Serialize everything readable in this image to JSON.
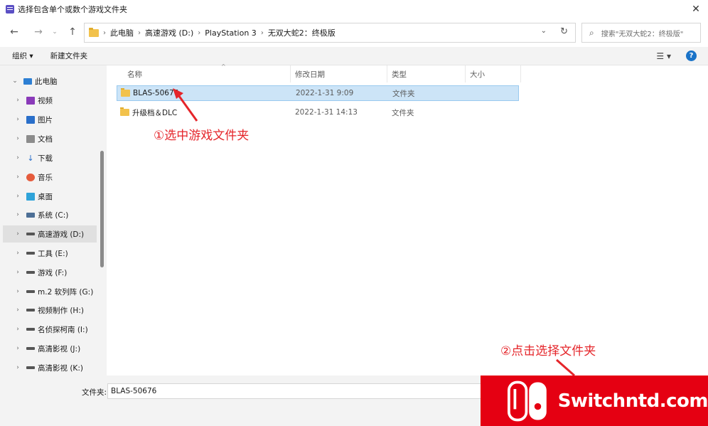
{
  "window": {
    "title": "选择包含单个或数个游戏文件夹",
    "close_glyph": "✕"
  },
  "nav": {
    "back": "←",
    "forward": "→",
    "recent": "⌄",
    "up": "↑"
  },
  "address": {
    "crumbs": [
      "此电脑",
      "高速游戏 (D:)",
      "PlayStation 3",
      "无双大蛇2：终极版"
    ],
    "separator": "›",
    "dropdown": "⌄",
    "refresh": "↻"
  },
  "search": {
    "placeholder": "搜索\"无双大蛇2：终极版\"",
    "icon": "search-icon"
  },
  "toolbar": {
    "organize": "组织 ▾",
    "new_folder": "新建文件夹",
    "view_glyph": "☰ ▾",
    "help_glyph": "?"
  },
  "tree": {
    "items": [
      {
        "label": "此电脑",
        "chev": "⌄",
        "icon": "pc-icon"
      },
      {
        "label": "视频",
        "chev": "›",
        "icon": "video-icon"
      },
      {
        "label": "图片",
        "chev": "›",
        "icon": "picture-icon"
      },
      {
        "label": "文档",
        "chev": "›",
        "icon": "document-icon"
      },
      {
        "label": "下载",
        "chev": "›",
        "icon": "download-icon"
      },
      {
        "label": "音乐",
        "chev": "›",
        "icon": "music-icon"
      },
      {
        "label": "桌面",
        "chev": "›",
        "icon": "desktop-icon"
      },
      {
        "label": "系统 (C:)",
        "chev": "›",
        "icon": "system-drive-icon"
      },
      {
        "label": "高速游戏 (D:)",
        "chev": "›",
        "icon": "drive-icon"
      },
      {
        "label": "工具 (E:)",
        "chev": "›",
        "icon": "drive-icon"
      },
      {
        "label": "游戏 (F:)",
        "chev": "›",
        "icon": "drive-icon"
      },
      {
        "label": "m.2 软列阵 (G:)",
        "chev": "›",
        "icon": "drive-icon"
      },
      {
        "label": "视频制作 (H:)",
        "chev": "›",
        "icon": "drive-icon"
      },
      {
        "label": "名侦探柯南 (I:)",
        "chev": "›",
        "icon": "drive-icon"
      },
      {
        "label": "高清影视 (J:)",
        "chev": "›",
        "icon": "drive-icon"
      },
      {
        "label": "高清影视 (K:)",
        "chev": "›",
        "icon": "drive-icon"
      }
    ]
  },
  "columns": {
    "name": "名称",
    "modified": "修改日期",
    "type": "类型",
    "size": "大小",
    "sort_glyph": "^"
  },
  "files": [
    {
      "name": "BLAS-50676",
      "modified": "2022-1-31 9:09",
      "type": "文件夹",
      "selected": true
    },
    {
      "name": "升级档＆DLC",
      "modified": "2022-1-31 14:13",
      "type": "文件夹",
      "selected": false
    }
  ],
  "annotations": {
    "step1": "①选中游戏文件夹",
    "step2": "②点击选择文件夹"
  },
  "footer": {
    "filename_label": "文件夹:",
    "filename_value": "BLAS-50676"
  },
  "watermark": {
    "text": "Switchntd.com"
  },
  "colors": {
    "accent": "#1a73c8",
    "selection": "#cce4f7",
    "annotation": "#e5252a",
    "watermark_bg": "#e50012"
  }
}
